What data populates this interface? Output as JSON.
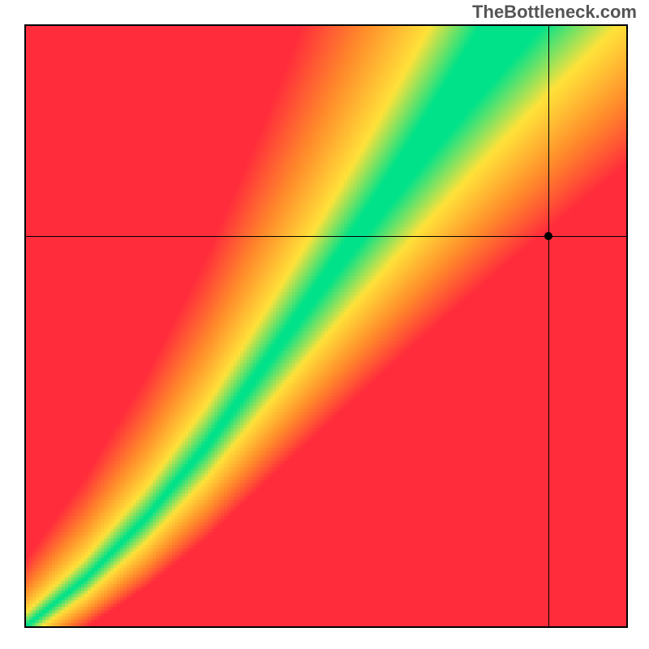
{
  "watermark": "TheBottleneck.com",
  "chart_data": {
    "type": "heatmap",
    "title": "",
    "xlabel": "",
    "ylabel": "",
    "xlim": [
      0,
      100
    ],
    "ylim": [
      0,
      100
    ],
    "color_scale_note": "red = poor, yellow = moderate, green = optimal",
    "optimal_curve_points": [
      {
        "x": 0,
        "y": 0
      },
      {
        "x": 10,
        "y": 8
      },
      {
        "x": 20,
        "y": 18
      },
      {
        "x": 30,
        "y": 30
      },
      {
        "x": 40,
        "y": 44
      },
      {
        "x": 50,
        "y": 58
      },
      {
        "x": 60,
        "y": 72
      },
      {
        "x": 70,
        "y": 86
      },
      {
        "x": 80,
        "y": 100
      }
    ],
    "crosshair": {
      "x": 87,
      "y": 65
    },
    "crosshair_estimated_region": "yellow"
  },
  "colors": {
    "red": "#ff2c3c",
    "orange": "#ff8a2b",
    "yellow": "#ffe23a",
    "green": "#00e28a"
  }
}
